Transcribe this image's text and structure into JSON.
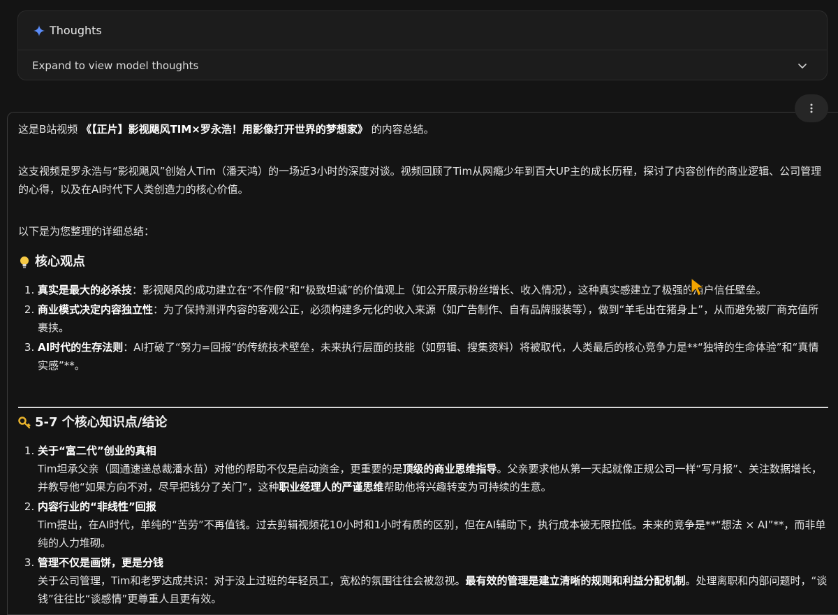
{
  "thoughts": {
    "title": "Thoughts",
    "expand_label": "Expand to view model thoughts"
  },
  "colors": {
    "sparkle": "#5b8cf7",
    "background": "#141414",
    "cursor": "#f2a400"
  },
  "icons": [
    "sparkle-icon",
    "chevron-down-icon",
    "more-vert-icon",
    "lightbulb-icon",
    "key-icon",
    "mouse-cursor-icon"
  ],
  "response": {
    "intro": {
      "pre": "这是B站视频 ",
      "title": "《【正片】影视飓风TIM×罗永浩！用影像打开世界的梦想家》",
      "post": " 的内容总结。"
    },
    "summary": "这支视频是罗永浩与“影视飓风”创始人Tim（潘天鸿）的一场近3小时的深度对谈。视频回顾了Tim从网瘾少年到百大UP主的成长历程，探讨了内容创作的商业逻辑、公司管理的心得，以及在AI时代下人类创造力的核心价值。",
    "lead": "以下是为您整理的详细总结：",
    "section1": {
      "heading": "核心观点",
      "items": [
        {
          "bold": "真实是最大的必杀技",
          "text": "：影视飓风的成功建立在“不作假”和“极致坦诚”的价值观上（如公开展示粉丝增长、收入情况），这种真实感建立了极强的用户信任壁垒。"
        },
        {
          "bold": "商业模式决定内容独立性",
          "text": "：为了保持测评内容的客观公正，必须构建多元化的收入来源（如广告制作、自有品牌服装等），做到“羊毛出在猪身上”，从而避免被厂商充值所裹挟。"
        },
        {
          "bold": "AI时代的生存法则",
          "text": "：AI打破了“努力=回报”的传统技术壁垒，未来执行层面的技能（如剪辑、搜集资料）将被取代，人类最后的核心竞争力是**“独特的生命体验”和“真情实感”**。"
        }
      ]
    },
    "section2": {
      "heading": "5-7 个核心知识点/结论",
      "items": [
        {
          "title": "关于“富二代”创业的真相",
          "t1": "Tim坦承父亲（圆通速递总裁潘水苗）对他的帮助不仅是启动资金，更重要的是",
          "b1": "顶级的商业思维指导",
          "t2": "。父亲要求他从第一天起就像正规公司一样“写月报”、关注数据增长，并教导他“如果方向不对，尽早把钱分了关门”，这种",
          "b2": "职业经理人的严谨思维",
          "t3": "帮助他将兴趣转变为可持续的生意。"
        },
        {
          "title": "内容行业的“非线性”回报",
          "t1": "Tim提出，在AI时代，单纯的“苦劳”不再值钱。过去剪辑视频花10小时和1小时有质的区别，但在AI辅助下，执行成本被无限拉低。未来的竞争是**“想法 × AI”**，而非单纯的人力堆砌。",
          "b1": "",
          "t2": "",
          "b2": "",
          "t3": ""
        },
        {
          "title": "管理不仅是画饼，更是分钱",
          "t1": "关于公司管理，Tim和老罗达成共识：对于没上过班的年轻员工，宽松的氛围往往会被忽视。",
          "b1": "最有效的管理是建立清晰的规则和利益分配机制",
          "t2": "。处理离职和内部问题时，“谈钱”往往比“谈感情”更尊重人且更有效。",
          "b2": "",
          "t3": ""
        }
      ]
    }
  }
}
